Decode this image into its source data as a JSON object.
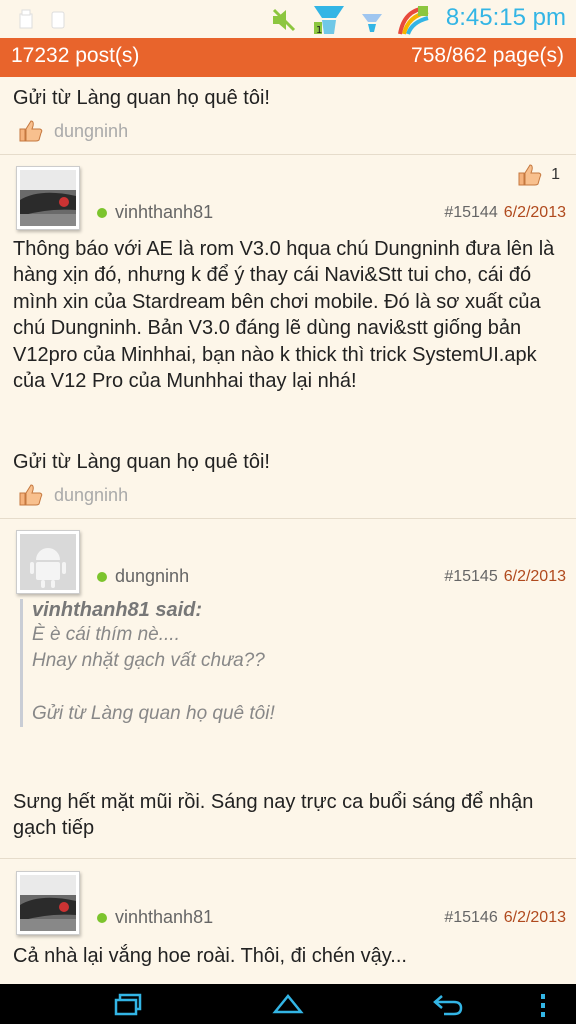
{
  "status_bar": {
    "time": "8:45:15 pm",
    "icons": [
      "usb-icon",
      "sd-card-icon",
      "mute-icon",
      "battery-icon",
      "signal-icon",
      "wifi-icon",
      "pen-icon"
    ]
  },
  "header": {
    "post_count": "17232 post(s)",
    "page_info": "758/862 page(s)"
  },
  "colors": {
    "accent": "#e8642c",
    "date": "#b04a1e",
    "online": "#7cc42d",
    "clock": "#33b5e5",
    "background": "#fdf6e9"
  },
  "posts": [
    {
      "signature": "Gửi từ Làng quan họ quê tôi!",
      "liker": "dungninh"
    },
    {
      "likes": "1",
      "user": "vinhthanh81",
      "post_number": "#15144",
      "date": "6/2/2013",
      "body": "Thông báo với AE là rom V3.0 hqua chú Dungninh đưa lên là hàng xịn đó, nhưng k để ý thay cái Navi&Stt tui cho, cái đó mình xin của Stardream bên chơi mobile. Đó là sơ xuất của chú Dungninh. Bản V3.0 đáng lẽ dùng navi&stt giống bản V12pro của Minhhai, bạn nào k thick thì trick SystemUI.apk của V12 Pro của Munhhai thay lại nhá!",
      "signature": "Gửi từ Làng quan họ quê tôi!",
      "liker": "dungninh"
    },
    {
      "user": "dungninh",
      "post_number": "#15145",
      "date": "6/2/2013",
      "quote_author": "vinhthanh81 said:",
      "quote_lines": [
        "È è cái thím nè....",
        "Hnay nhặt gạch vất chưa??",
        "",
        "Gửi từ Làng quan họ quê tôi!"
      ],
      "body": "Sưng hết mặt mũi rồi. Sáng nay trực ca buổi sáng để nhận gạch tiếp"
    },
    {
      "user": "vinhthanh81",
      "post_number": "#15146",
      "date": "6/2/2013",
      "body": "Cả nhà lại vắng hoe roài. Thôi, đi chén vậy..."
    }
  ],
  "nav": {
    "buttons": [
      "recent-apps-icon",
      "home-icon",
      "back-icon",
      "menu-icon"
    ]
  }
}
